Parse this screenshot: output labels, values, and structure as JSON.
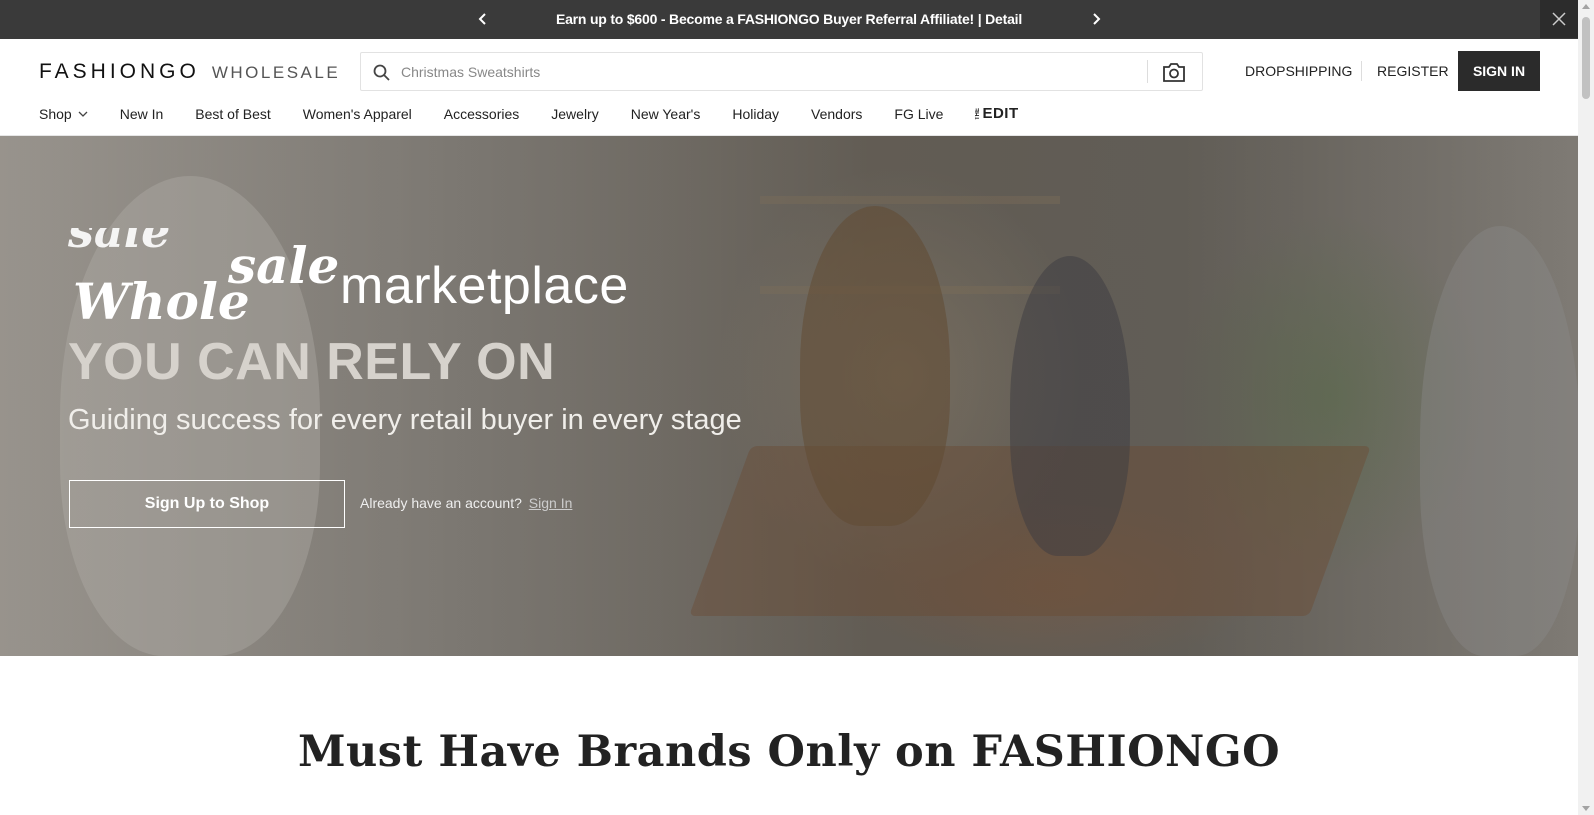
{
  "promo": {
    "text": "Earn up to $600 - Become a FASHIONGO Buyer Referral Affiliate! | Detail",
    "prev_icon": "chevron-left-icon",
    "next_icon": "chevron-right-icon",
    "close_icon": "close-icon"
  },
  "header": {
    "logo_main": "FASHIONGO",
    "logo_sub": "WHOLESALE",
    "search": {
      "placeholder": "Christmas Sweatshirts",
      "icon": "search-icon",
      "camera_icon": "camera-icon"
    },
    "links": {
      "dropshipping": "DROPSHIPPING",
      "register": "REGISTER",
      "sign_in": "SIGN IN"
    }
  },
  "nav": {
    "items": [
      {
        "label": "Shop"
      },
      {
        "label": "New In"
      },
      {
        "label": "Best of Best"
      },
      {
        "label": "Women's Apparel"
      },
      {
        "label": "Accessories"
      },
      {
        "label": "Jewelry"
      },
      {
        "label": "New Year's"
      },
      {
        "label": "Holiday"
      },
      {
        "label": "Vendors"
      },
      {
        "label": "FG Live"
      }
    ],
    "edit_prefix": "THE",
    "edit_label": "EDIT"
  },
  "hero": {
    "script_word_1": "sale",
    "script_word_2": "sale",
    "script_word_3": "Whole",
    "marketplace": "marketplace",
    "title": "YOU CAN RELY ON",
    "subtitle": "Guiding success for every retail buyer in every stage",
    "cta": "Sign Up to Shop",
    "account_text": "Already have an account?",
    "account_link": "Sign In"
  },
  "section": {
    "title": "Must Have Brands Only on FASHIONGO"
  },
  "colors": {
    "promo_bg": "#3a3a3a",
    "signin_bg": "#2b2b2b",
    "text": "#222222"
  }
}
